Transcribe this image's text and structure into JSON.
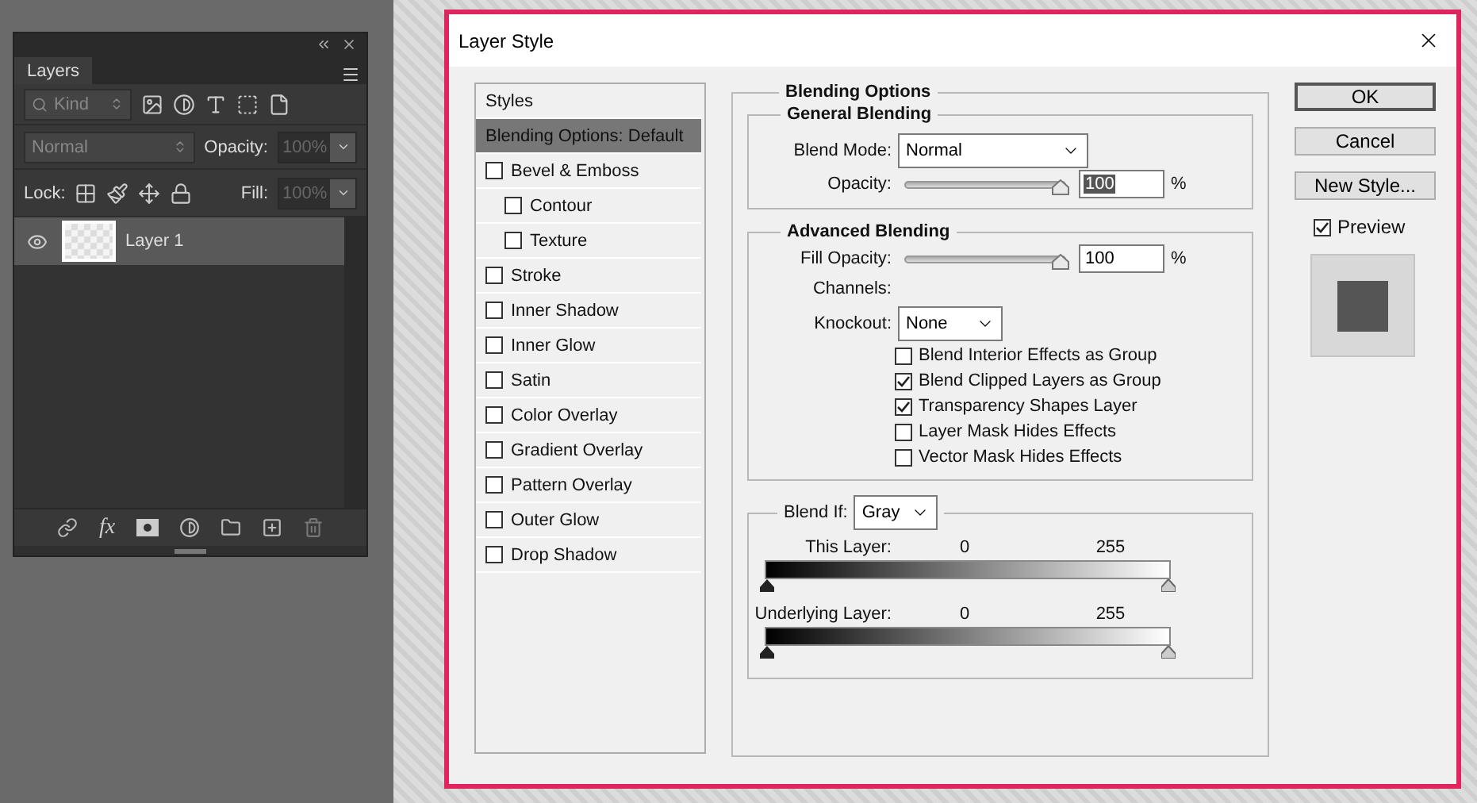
{
  "layers_panel": {
    "tab": "Layers",
    "filter": {
      "placeholder": "Kind"
    },
    "blend_mode": "Normal",
    "opacity_label": "Opacity:",
    "opacity": "100%",
    "lock_label": "Lock:",
    "fill_label": "Fill:",
    "fill": "100%",
    "layers": [
      {
        "name": "Layer 1",
        "visible": true,
        "selected": true
      }
    ],
    "fx": "fx"
  },
  "dialog": {
    "title": "Layer Style",
    "styles_header": "Styles",
    "styles": [
      {
        "label": "Blending Options: Default",
        "kind": "plain",
        "selected": true
      },
      {
        "label": "Bevel & Emboss",
        "kind": "check",
        "checked": false,
        "selected": false,
        "children": [
          {
            "label": "Contour",
            "kind": "check",
            "checked": false,
            "selected": false
          },
          {
            "label": "Texture",
            "kind": "check",
            "checked": false,
            "selected": false
          }
        ]
      },
      {
        "label": "Stroke",
        "kind": "check",
        "checked": false,
        "selected": false
      },
      {
        "label": "Inner Shadow",
        "kind": "check",
        "checked": false,
        "selected": false
      },
      {
        "label": "Inner Glow",
        "kind": "check",
        "checked": false,
        "selected": false
      },
      {
        "label": "Satin",
        "kind": "check",
        "checked": false,
        "selected": false
      },
      {
        "label": "Color Overlay",
        "kind": "check",
        "checked": false,
        "selected": false
      },
      {
        "label": "Gradient Overlay",
        "kind": "check",
        "checked": false,
        "selected": false
      },
      {
        "label": "Pattern Overlay",
        "kind": "check",
        "checked": false,
        "selected": false
      },
      {
        "label": "Outer Glow",
        "kind": "check",
        "checked": false,
        "selected": false
      },
      {
        "label": "Drop Shadow",
        "kind": "check",
        "checked": false,
        "selected": false
      }
    ],
    "blending": {
      "title": "Blending Options",
      "general": {
        "title": "General Blending",
        "blend_mode_label": "Blend Mode:",
        "blend_mode": "Normal",
        "opacity": {
          "label": "Opacity:",
          "level": 1,
          "value": "100",
          "unit": "%",
          "highlighted": true
        }
      },
      "advanced": {
        "title": "Advanced Blending",
        "fill_opacity": {
          "label": "Fill Opacity:",
          "level": 1,
          "value": "100",
          "unit": "%",
          "highlighted": false
        },
        "channels_label": "Channels:",
        "knockout_label": "Knockout:",
        "knockout": "None",
        "options": [
          {
            "label": "Blend Interior Effects as Group",
            "checked": false
          },
          {
            "label": "Blend Clipped Layers as Group",
            "checked": true
          },
          {
            "label": "Transparency Shapes Layer",
            "checked": true
          },
          {
            "label": "Layer Mask Hides Effects",
            "checked": false
          },
          {
            "label": "Vector Mask Hides Effects",
            "checked": false
          }
        ]
      },
      "blend_if": {
        "label": "Blend If:",
        "value": "Gray",
        "ranges": [
          {
            "label": "This Layer:",
            "low": "0",
            "high": "255"
          },
          {
            "label": "Underlying Layer:",
            "low": "0",
            "high": "255"
          }
        ]
      }
    },
    "buttons": [
      {
        "label": "OK",
        "default": true
      },
      {
        "label": "Cancel",
        "default": false
      },
      {
        "label": "New Style...",
        "default": false
      }
    ],
    "preview": {
      "label": "Preview",
      "checked": true
    }
  }
}
